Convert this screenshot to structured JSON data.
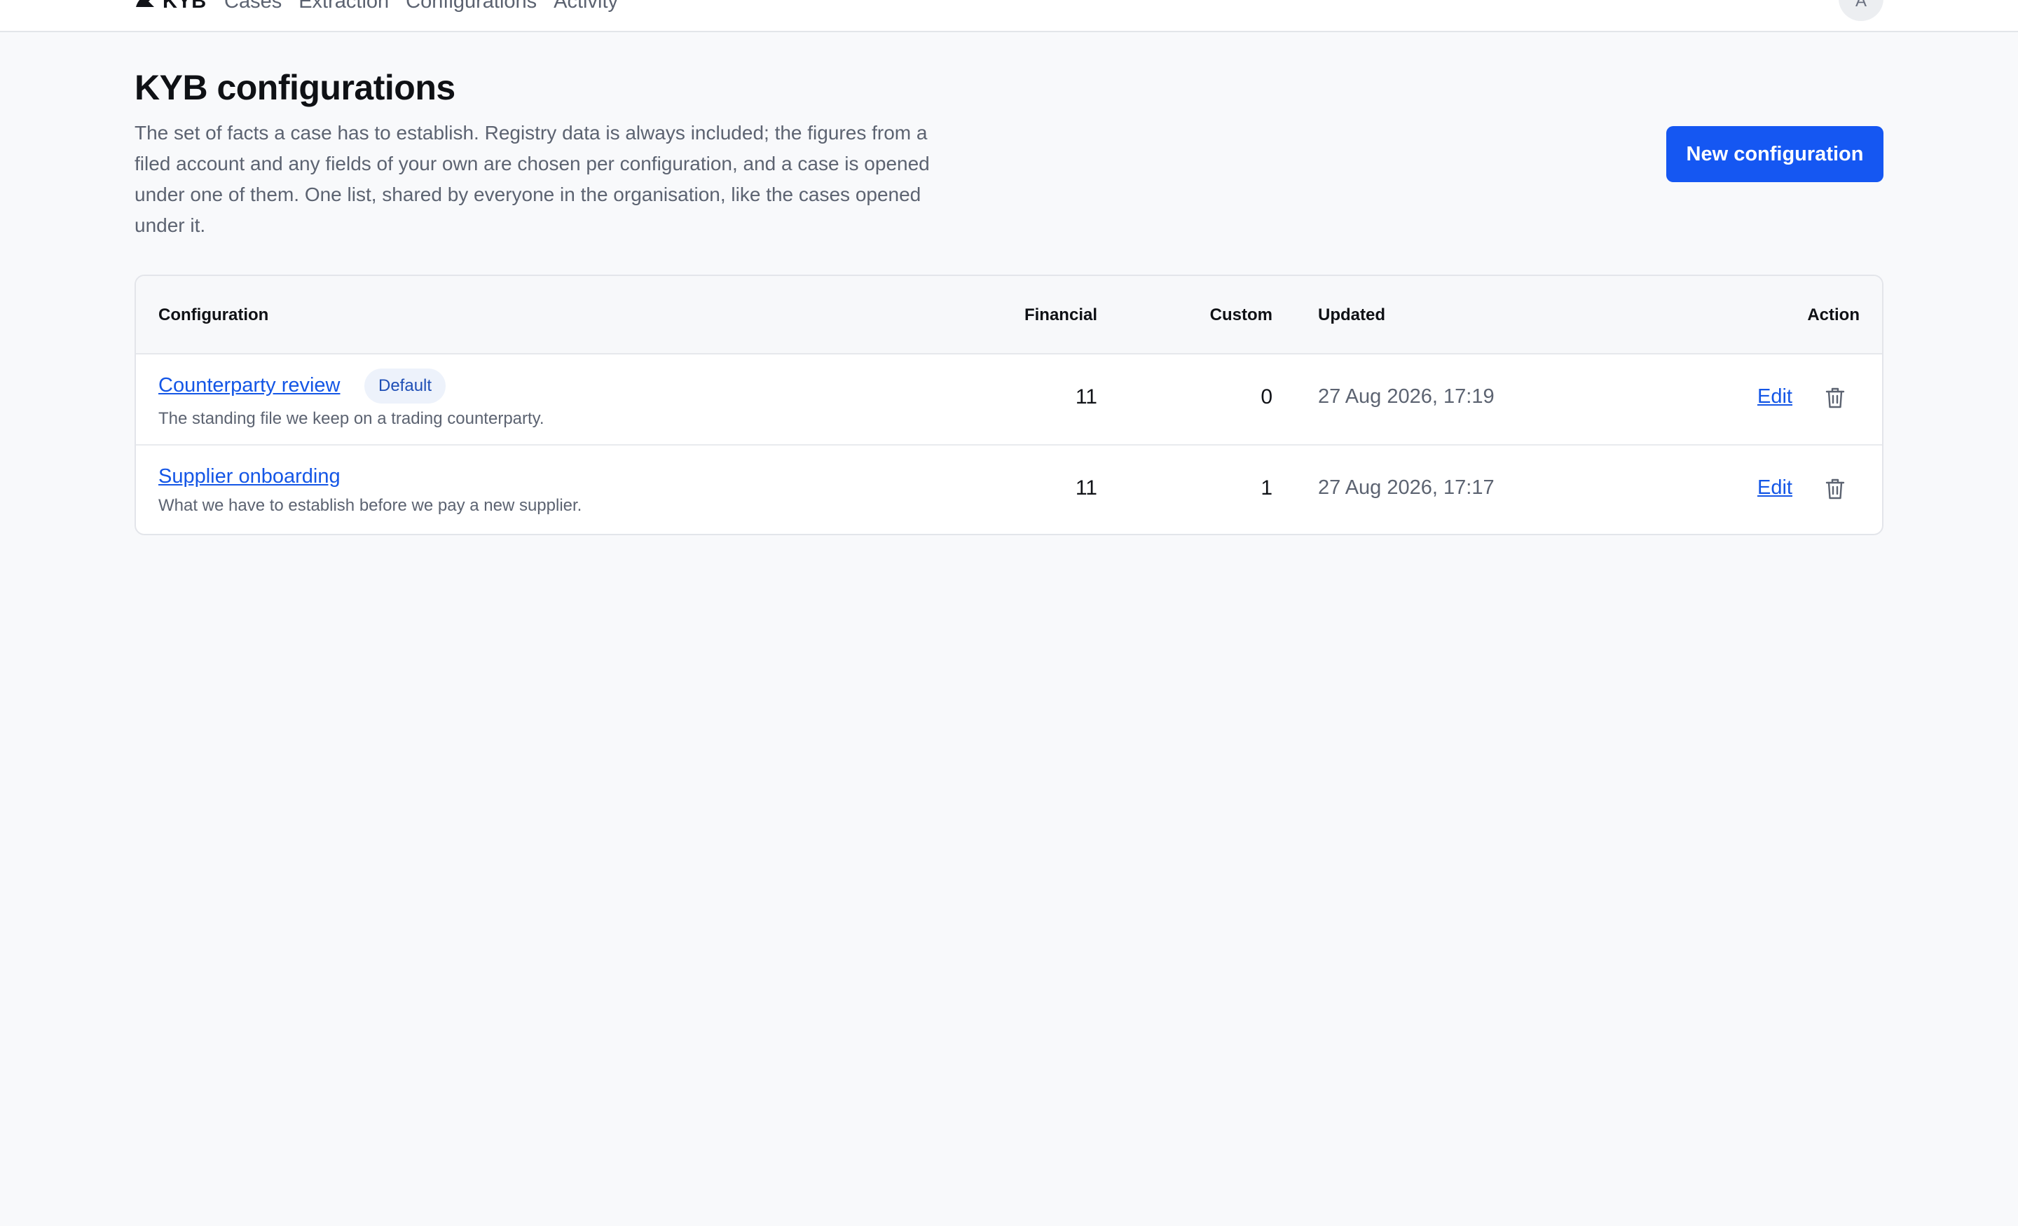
{
  "nav": {
    "brand": "KYB",
    "items": [
      "Cases",
      "Extraction",
      "Configurations",
      "Activity"
    ],
    "avatar_initial": "A"
  },
  "header": {
    "title": "KYB configurations",
    "description": "The set of facts a case has to establish. Registry data is always included; the figures from a filed account and any fields of your own are chosen per configuration, and a case is opened under one of them. One list, shared by everyone in the organisation, like the cases opened under it.",
    "new_button": "New configuration"
  },
  "table": {
    "columns": {
      "configuration": "Configuration",
      "financial": "Financial",
      "custom": "Custom",
      "updated": "Updated",
      "action": "Action"
    },
    "rows": [
      {
        "name": "Counterparty review",
        "badge": "Default",
        "description": "The standing file we keep on a trading counterparty.",
        "financial": "11",
        "custom": "0",
        "updated": "27 Aug 2026, 17:19",
        "edit": "Edit"
      },
      {
        "name": "Supplier onboarding",
        "badge": "",
        "description": "What we have to establish before we pay a new supplier.",
        "financial": "11",
        "custom": "1",
        "updated": "27 Aug 2026, 17:17",
        "edit": "Edit"
      }
    ]
  },
  "colors": {
    "primary": "#1557f2",
    "link": "#1456e6",
    "background": "#f8f9fb"
  },
  "icons": [
    "kyb-logo-icon",
    "trash-icon"
  ]
}
